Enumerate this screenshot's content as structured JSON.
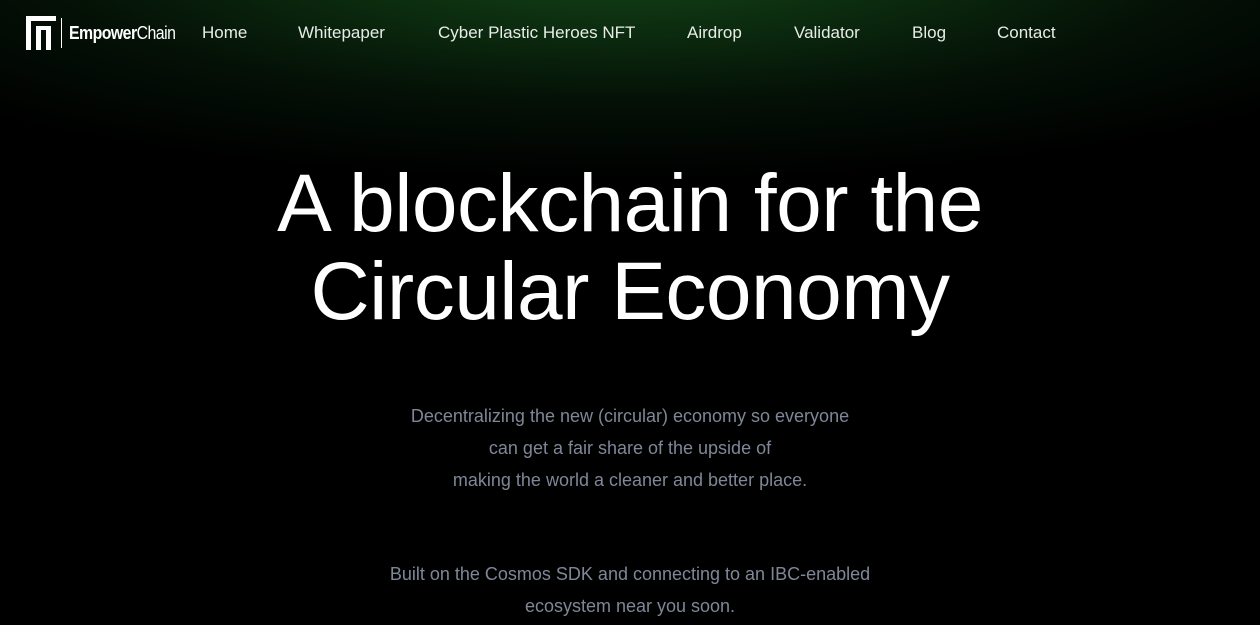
{
  "brand": {
    "name_bold": "Empower",
    "name_light": "Chain",
    "logo_icon": "empowerchain-logo-icon"
  },
  "nav": {
    "items": [
      {
        "label": "Home"
      },
      {
        "label": "Whitepaper"
      },
      {
        "label": "Cyber Plastic Heroes NFT"
      },
      {
        "label": "Airdrop"
      },
      {
        "label": "Validator"
      },
      {
        "label": "Blog"
      },
      {
        "label": "Contact"
      }
    ]
  },
  "hero": {
    "title_line1": "A blockchain for the",
    "title_line2": "Circular Economy",
    "subtitle_lines": [
      "Decentralizing the new (circular) economy so everyone",
      "can get a fair share of the upside of",
      "making the world a cleaner and better place."
    ],
    "subtitle2_lines": [
      "Built on the Cosmos SDK and connecting to an IBC-enabled",
      "ecosystem near you soon."
    ]
  },
  "colors": {
    "background": "#000000",
    "glow": "#15461a",
    "text_primary": "#ffffff",
    "text_muted": "#7f8797"
  }
}
